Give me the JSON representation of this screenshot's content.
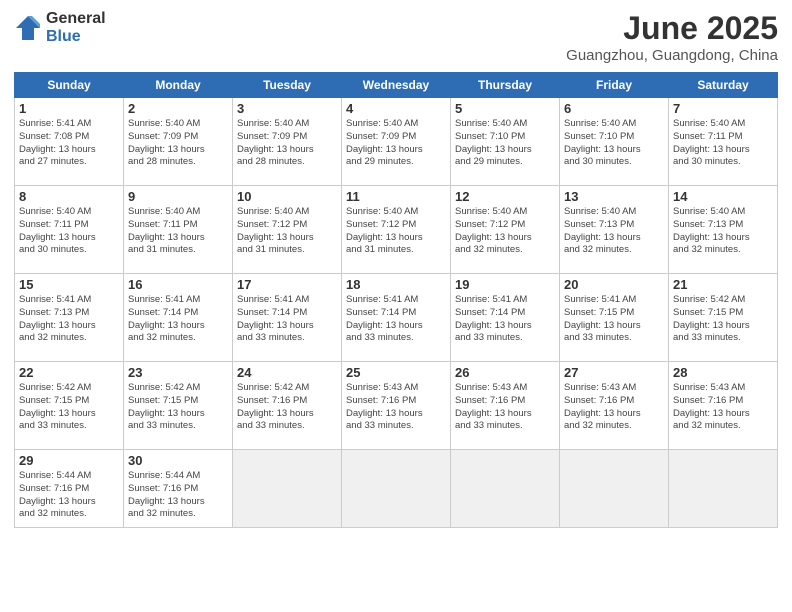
{
  "logo": {
    "general": "General",
    "blue": "Blue"
  },
  "title": "June 2025",
  "subtitle": "Guangzhou, Guangdong, China",
  "days_of_week": [
    "Sunday",
    "Monday",
    "Tuesday",
    "Wednesday",
    "Thursday",
    "Friday",
    "Saturday"
  ],
  "cells": [
    {
      "day": "",
      "empty": true
    },
    {
      "day": "",
      "empty": true
    },
    {
      "day": "",
      "empty": true
    },
    {
      "day": "",
      "empty": true
    },
    {
      "day": "",
      "empty": true
    },
    {
      "day": "",
      "empty": true
    },
    {
      "day": "",
      "empty": true
    },
    {
      "day": "1",
      "info": "Sunrise: 5:41 AM\nSunset: 7:08 PM\nDaylight: 13 hours\nand 27 minutes."
    },
    {
      "day": "2",
      "info": "Sunrise: 5:40 AM\nSunset: 7:09 PM\nDaylight: 13 hours\nand 28 minutes."
    },
    {
      "day": "3",
      "info": "Sunrise: 5:40 AM\nSunset: 7:09 PM\nDaylight: 13 hours\nand 28 minutes."
    },
    {
      "day": "4",
      "info": "Sunrise: 5:40 AM\nSunset: 7:09 PM\nDaylight: 13 hours\nand 29 minutes."
    },
    {
      "day": "5",
      "info": "Sunrise: 5:40 AM\nSunset: 7:10 PM\nDaylight: 13 hours\nand 29 minutes."
    },
    {
      "day": "6",
      "info": "Sunrise: 5:40 AM\nSunset: 7:10 PM\nDaylight: 13 hours\nand 30 minutes."
    },
    {
      "day": "7",
      "info": "Sunrise: 5:40 AM\nSunset: 7:11 PM\nDaylight: 13 hours\nand 30 minutes."
    },
    {
      "day": "8",
      "info": "Sunrise: 5:40 AM\nSunset: 7:11 PM\nDaylight: 13 hours\nand 30 minutes."
    },
    {
      "day": "9",
      "info": "Sunrise: 5:40 AM\nSunset: 7:11 PM\nDaylight: 13 hours\nand 31 minutes."
    },
    {
      "day": "10",
      "info": "Sunrise: 5:40 AM\nSunset: 7:12 PM\nDaylight: 13 hours\nand 31 minutes."
    },
    {
      "day": "11",
      "info": "Sunrise: 5:40 AM\nSunset: 7:12 PM\nDaylight: 13 hours\nand 31 minutes."
    },
    {
      "day": "12",
      "info": "Sunrise: 5:40 AM\nSunset: 7:12 PM\nDaylight: 13 hours\nand 32 minutes."
    },
    {
      "day": "13",
      "info": "Sunrise: 5:40 AM\nSunset: 7:13 PM\nDaylight: 13 hours\nand 32 minutes."
    },
    {
      "day": "14",
      "info": "Sunrise: 5:40 AM\nSunset: 7:13 PM\nDaylight: 13 hours\nand 32 minutes."
    },
    {
      "day": "15",
      "info": "Sunrise: 5:41 AM\nSunset: 7:13 PM\nDaylight: 13 hours\nand 32 minutes."
    },
    {
      "day": "16",
      "info": "Sunrise: 5:41 AM\nSunset: 7:14 PM\nDaylight: 13 hours\nand 32 minutes."
    },
    {
      "day": "17",
      "info": "Sunrise: 5:41 AM\nSunset: 7:14 PM\nDaylight: 13 hours\nand 33 minutes."
    },
    {
      "day": "18",
      "info": "Sunrise: 5:41 AM\nSunset: 7:14 PM\nDaylight: 13 hours\nand 33 minutes."
    },
    {
      "day": "19",
      "info": "Sunrise: 5:41 AM\nSunset: 7:14 PM\nDaylight: 13 hours\nand 33 minutes."
    },
    {
      "day": "20",
      "info": "Sunrise: 5:41 AM\nSunset: 7:15 PM\nDaylight: 13 hours\nand 33 minutes."
    },
    {
      "day": "21",
      "info": "Sunrise: 5:42 AM\nSunset: 7:15 PM\nDaylight: 13 hours\nand 33 minutes."
    },
    {
      "day": "22",
      "info": "Sunrise: 5:42 AM\nSunset: 7:15 PM\nDaylight: 13 hours\nand 33 minutes."
    },
    {
      "day": "23",
      "info": "Sunrise: 5:42 AM\nSunset: 7:15 PM\nDaylight: 13 hours\nand 33 minutes."
    },
    {
      "day": "24",
      "info": "Sunrise: 5:42 AM\nSunset: 7:16 PM\nDaylight: 13 hours\nand 33 minutes."
    },
    {
      "day": "25",
      "info": "Sunrise: 5:43 AM\nSunset: 7:16 PM\nDaylight: 13 hours\nand 33 minutes."
    },
    {
      "day": "26",
      "info": "Sunrise: 5:43 AM\nSunset: 7:16 PM\nDaylight: 13 hours\nand 33 minutes."
    },
    {
      "day": "27",
      "info": "Sunrise: 5:43 AM\nSunset: 7:16 PM\nDaylight: 13 hours\nand 32 minutes."
    },
    {
      "day": "28",
      "info": "Sunrise: 5:43 AM\nSunset: 7:16 PM\nDaylight: 13 hours\nand 32 minutes."
    },
    {
      "day": "29",
      "info": "Sunrise: 5:44 AM\nSunset: 7:16 PM\nDaylight: 13 hours\nand 32 minutes."
    },
    {
      "day": "30",
      "info": "Sunrise: 5:44 AM\nSunset: 7:16 PM\nDaylight: 13 hours\nand 32 minutes."
    },
    {
      "day": "",
      "empty": true
    },
    {
      "day": "",
      "empty": true
    },
    {
      "day": "",
      "empty": true
    },
    {
      "day": "",
      "empty": true
    },
    {
      "day": "",
      "empty": true
    }
  ]
}
